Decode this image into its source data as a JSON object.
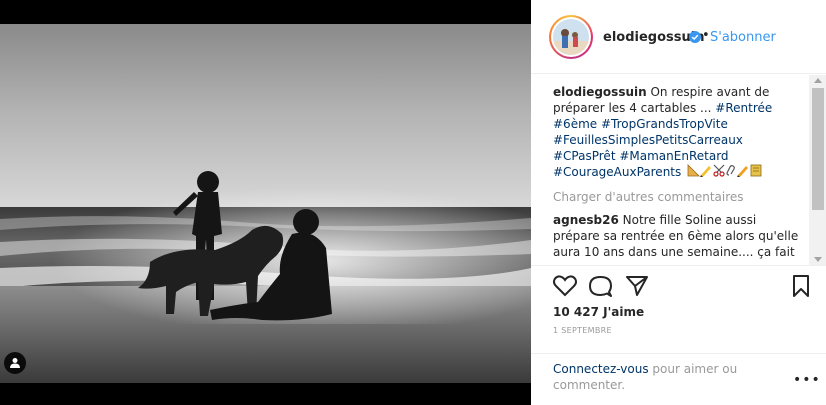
{
  "post": {
    "username": "elodiegossuin",
    "follow_label": "S'abonner",
    "header_dot": "•"
  },
  "caption": {
    "username": "elodiegossuin",
    "text": "On respire avant de préparer les 4 cartables ... ",
    "hashtags": [
      "#Rentrée",
      "#6ème",
      "#TropGrandsTropVite",
      "#FeuillesSimplesPetitsCarreaux",
      "#CPasPrêt",
      "#MamanEnRetard",
      "#CourageAuxParents"
    ],
    "emoji_icons": [
      "set-square-icon",
      "pencil-icon",
      "scissors-icon",
      "paperclip-icon",
      "pencil-icon",
      "notebook-icon"
    ]
  },
  "comments": {
    "load_more_label": "Charger d'autres commentaires",
    "items": [
      {
        "username": "agnesb26",
        "text": "Notre fille Soline aussi prépare sa rentrée en 6ème alors qu'elle aura 10 ans dans une semaine.... ça fait"
      }
    ]
  },
  "actions": {
    "likes": "10 427 J'aime",
    "date": "1 SEPTEMBRE"
  },
  "login_prompt": {
    "link": "Connectez-vous",
    "text": " pour aimer ou commenter.",
    "more_label": "•••"
  },
  "colors": {
    "link_blue": "#3897f0",
    "hashtag": "#003569",
    "muted": "#999999",
    "text": "#262626"
  }
}
